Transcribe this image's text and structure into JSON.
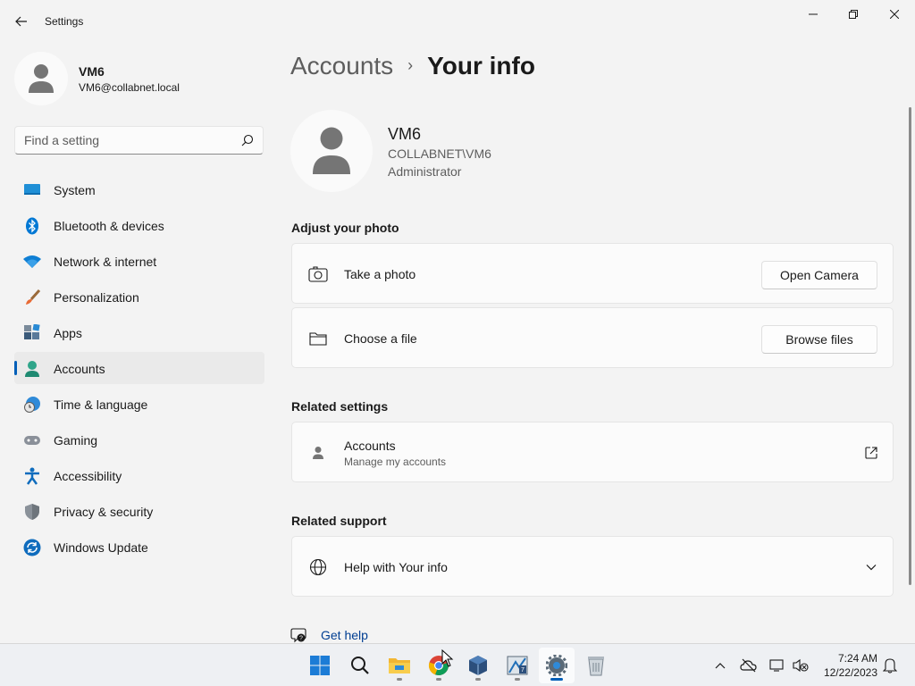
{
  "window": {
    "title": "Settings"
  },
  "profile": {
    "name": "VM6",
    "email": "VM6@collabnet.local"
  },
  "search": {
    "placeholder": "Find a setting"
  },
  "sidebar": {
    "items": [
      {
        "label": "System",
        "icon": "system-icon"
      },
      {
        "label": "Bluetooth & devices",
        "icon": "bluetooth-icon"
      },
      {
        "label": "Network & internet",
        "icon": "wifi-icon"
      },
      {
        "label": "Personalization",
        "icon": "paintbrush-icon"
      },
      {
        "label": "Apps",
        "icon": "apps-icon"
      },
      {
        "label": "Accounts",
        "icon": "accounts-icon",
        "selected": true
      },
      {
        "label": "Time & language",
        "icon": "globe-clock-icon"
      },
      {
        "label": "Gaming",
        "icon": "gamepad-icon"
      },
      {
        "label": "Accessibility",
        "icon": "accessibility-icon"
      },
      {
        "label": "Privacy & security",
        "icon": "shield-icon"
      },
      {
        "label": "Windows Update",
        "icon": "update-icon"
      }
    ]
  },
  "breadcrumb": {
    "parent": "Accounts",
    "separator": "›",
    "current": "Your info"
  },
  "user": {
    "name": "VM6",
    "domain": "COLLABNET\\VM6",
    "role": "Administrator"
  },
  "adjust_photo": {
    "title": "Adjust your photo",
    "take_photo_label": "Take a photo",
    "open_camera_button": "Open Camera",
    "choose_file_label": "Choose a file",
    "browse_files_button": "Browse files"
  },
  "related_settings": {
    "title": "Related settings",
    "accounts_label": "Accounts",
    "accounts_sub": "Manage my accounts"
  },
  "related_support": {
    "title": "Related support",
    "help_label": "Help with Your info"
  },
  "get_help": {
    "label": "Get help"
  },
  "taskbar": {
    "apps": [
      "start-icon",
      "search-icon",
      "file-explorer-icon",
      "chrome-icon",
      "virtualbox-icon",
      "app-icon",
      "settings-icon",
      "recycle-bin-icon"
    ],
    "time": "7:24 AM",
    "date": "12/22/2023"
  },
  "colors": {
    "accent": "#005fb8",
    "background": "#f3f3f3",
    "card": "#fbfbfb"
  }
}
